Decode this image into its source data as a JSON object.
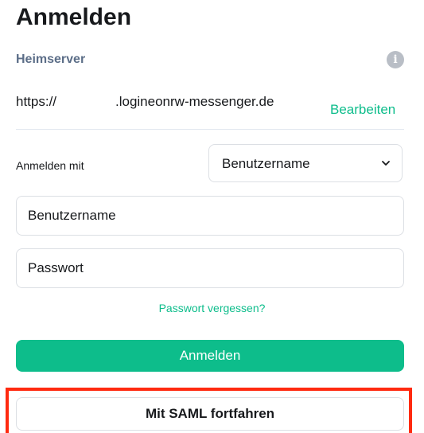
{
  "header": {
    "title": "Anmelden"
  },
  "homeserver": {
    "label": "Heimserver",
    "info_icon": "info-icon",
    "url_prefix": "https://",
    "url_domain": ".logineonrw-messenger.de",
    "edit_label": "Bearbeiten"
  },
  "login_with": {
    "label": "Anmelden mit",
    "selected": "Benutzername",
    "chevron_icon": "chevron-down-icon"
  },
  "form": {
    "username_placeholder": "Benutzername",
    "password_placeholder": "Passwort",
    "forgot_label": "Passwort vergessen?",
    "submit_label": "Anmelden"
  },
  "saml": {
    "label": "Mit SAML fortfahren",
    "highlight_color": "#ff2a10"
  },
  "colors": {
    "accent": "#0dbd8b",
    "label": "#5c6e88",
    "text": "#17191c",
    "border": "#dcdfe4"
  }
}
